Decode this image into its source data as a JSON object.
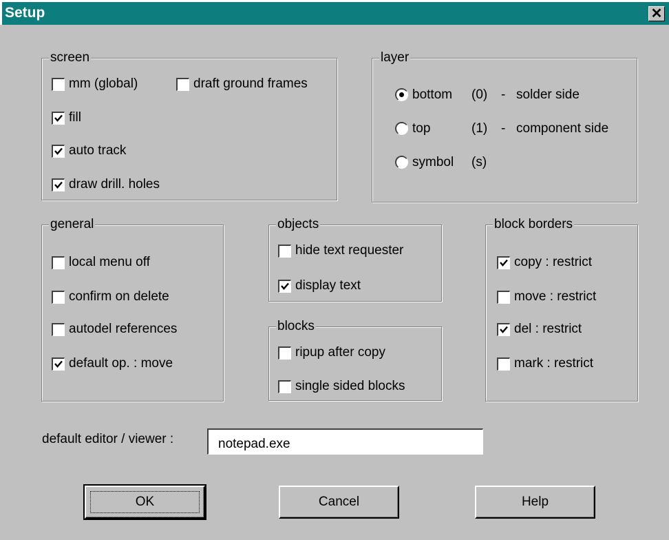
{
  "window": {
    "title": "Setup",
    "close_glyph": "✕",
    "close_icon": "close-icon"
  },
  "screen": {
    "legend": "screen",
    "items": [
      {
        "label": "mm (global)",
        "checked": false
      },
      {
        "label": "draft ground frames",
        "checked": false
      },
      {
        "label": "fill",
        "checked": true
      },
      {
        "label": "auto track",
        "checked": true
      },
      {
        "label": "draw drill. holes",
        "checked": true
      }
    ]
  },
  "layer": {
    "legend": "layer",
    "options": [
      {
        "label": "bottom",
        "code": "(0)",
        "dash": "-",
        "desc": "solder side",
        "selected": true
      },
      {
        "label": "top",
        "code": "(1)",
        "dash": "-",
        "desc": "component side",
        "selected": false
      },
      {
        "label": "symbol",
        "code": "(s)",
        "dash": "",
        "desc": "",
        "selected": false
      }
    ]
  },
  "general": {
    "legend": "general",
    "items": [
      {
        "label": "local menu off",
        "checked": false
      },
      {
        "label": "confirm on delete",
        "checked": false
      },
      {
        "label": "autodel references",
        "checked": false
      },
      {
        "label": "default op. : move",
        "checked": true
      }
    ]
  },
  "objects": {
    "legend": "objects",
    "items": [
      {
        "label": "hide text requester",
        "checked": false
      },
      {
        "label": "display text",
        "checked": true
      }
    ]
  },
  "blocks": {
    "legend": "blocks",
    "items": [
      {
        "label": "ripup after copy",
        "checked": false
      },
      {
        "label": "single sided blocks",
        "checked": false
      }
    ]
  },
  "block_borders": {
    "legend": "block borders",
    "items": [
      {
        "label": "copy : restrict",
        "checked": true
      },
      {
        "label": "move : restrict",
        "checked": false
      },
      {
        "label": "del : restrict",
        "checked": true
      },
      {
        "label": "mark : restrict",
        "checked": false
      }
    ]
  },
  "editor": {
    "label": "default editor / viewer :",
    "value": "notepad.exe"
  },
  "buttons": {
    "ok": "OK",
    "cancel": "Cancel",
    "help": "Help"
  },
  "colors": {
    "titlebar": "#0e7d7d",
    "face": "#c0c0c0"
  }
}
